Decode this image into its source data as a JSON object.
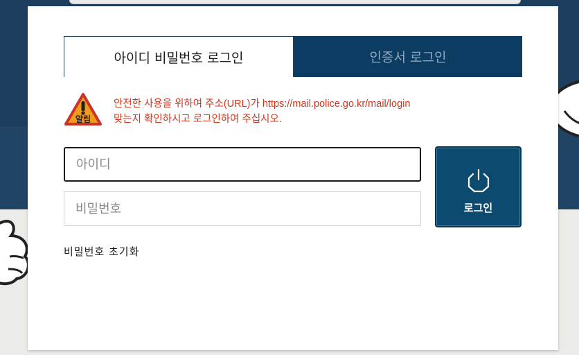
{
  "tabs": {
    "id_password_login": "아이디 비밀번호 로그인",
    "certificate_login": "인증서 로그인"
  },
  "notice": {
    "icon_label": "알림",
    "line1": "안전한 사용을 위하여 주소(URL)가 https://mail.police.go.kr/mail/login",
    "line2": "맞는지 확인하시고 로그인하여 주십시오.",
    "color": "#d2361c"
  },
  "form": {
    "id_placeholder": "아이디",
    "password_placeholder": "비밀번호",
    "login_label": "로그인",
    "reset_password_label": "비밀번호 초기화"
  },
  "colors": {
    "brand_navy": "#0d3c63",
    "button": "#0d4a70"
  },
  "icons": [
    "alert-icon",
    "power-icon"
  ]
}
